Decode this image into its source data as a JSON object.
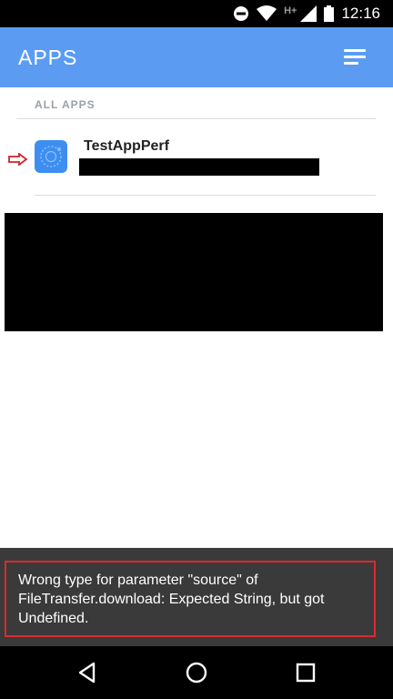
{
  "status_bar": {
    "time": "12:16",
    "network_label": "H+",
    "icons": [
      "do-not-disturb-icon",
      "wifi-icon",
      "signal-icon",
      "battery-icon"
    ]
  },
  "app_bar": {
    "title": "APPS",
    "menu_icon": "menu-icon",
    "color": "#5b9cf2"
  },
  "section": {
    "header": "ALL APPS"
  },
  "apps": [
    {
      "name": "TestAppPerf",
      "icon": "app-logo-icon"
    }
  ],
  "toast": {
    "message": "Wrong type for parameter \"source\" of FileTransfer.download: Expected String, but got Undefined.",
    "highlight_color": "#e0282e"
  },
  "nav_bar": {
    "icons": [
      "back-icon",
      "home-icon",
      "recents-icon"
    ]
  }
}
